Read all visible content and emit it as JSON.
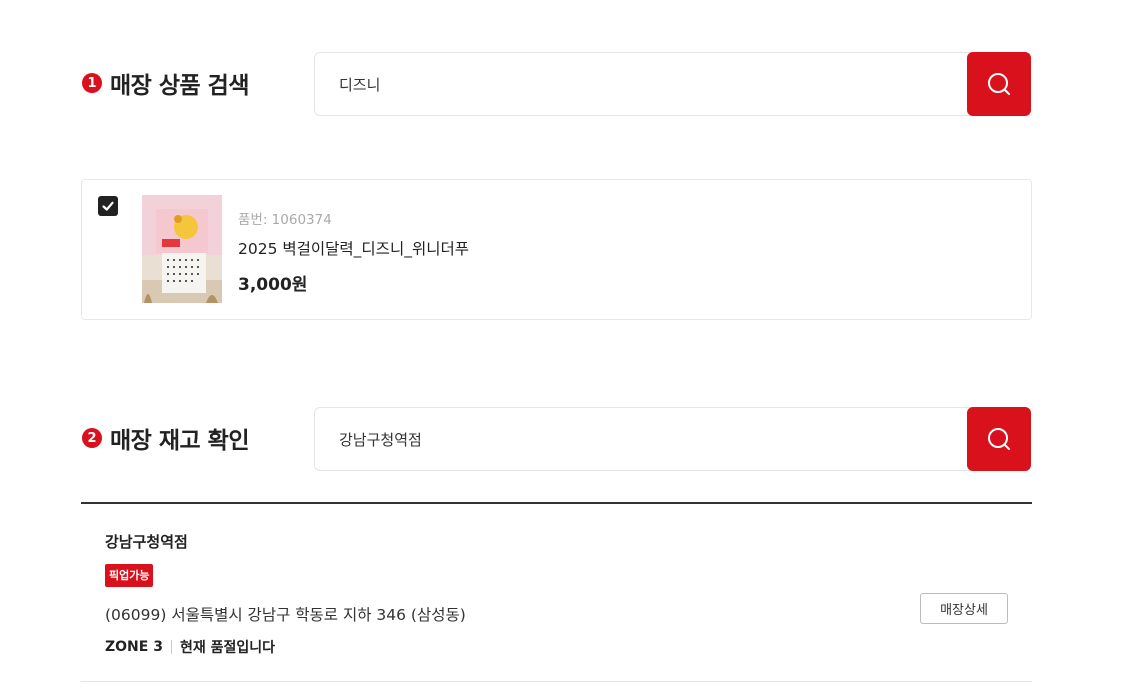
{
  "section1": {
    "step": "1",
    "title": "매장 상품 검색",
    "search_value": "디즈니",
    "search_icon": "search-icon"
  },
  "product": {
    "checked": true,
    "code_text": "품번: 1060374",
    "name": "2025 벽걸이달력_디즈니_위니더푸",
    "price": "3,000원",
    "thumbnail_label": "calendar-thumbnail"
  },
  "section2": {
    "step": "2",
    "title": "매장 재고 확인",
    "search_value": "강남구청역점",
    "search_icon": "search-icon"
  },
  "store": {
    "name": "강남구청역점",
    "badge": "픽업가능",
    "address": "(06099) 서울특별시 강남구 학동로 지하 346 (삼성동)",
    "zone": "ZONE 3",
    "stock_status": "현재 품절입니다",
    "detail_button": "매장상세"
  },
  "colors": {
    "accent": "#d8111d",
    "text": "#222222",
    "muted": "#aaaaaa",
    "border": "#e5e5e5"
  }
}
